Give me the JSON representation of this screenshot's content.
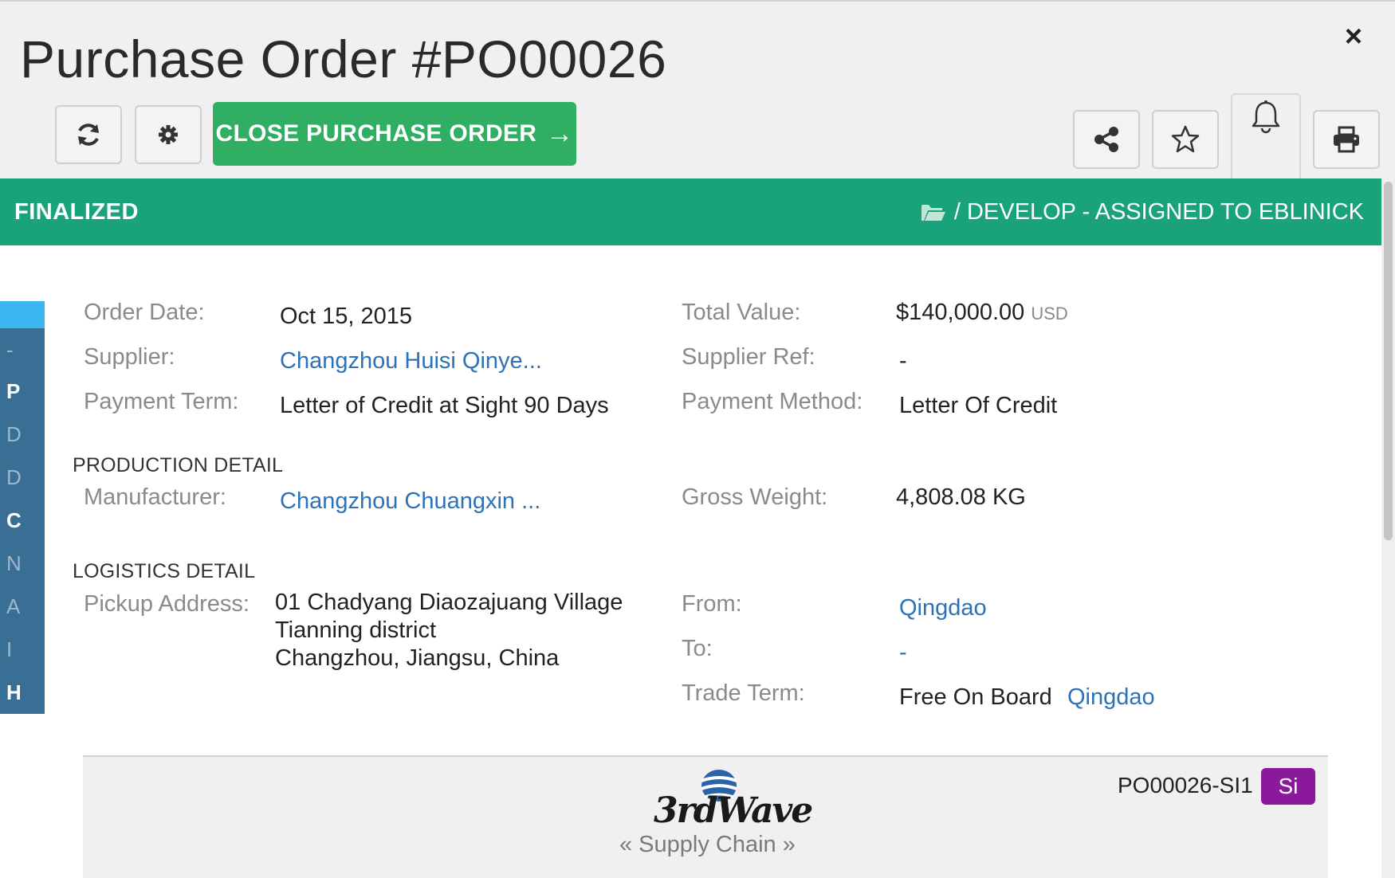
{
  "header": {
    "title": "Purchase Order #PO00026",
    "close_icon": "×",
    "primary_action": "CLOSE PURCHASE ORDER",
    "primary_action_arrow": "→"
  },
  "status": {
    "state": "FINALIZED",
    "project": "/ DEVELOP - ASSIGNED TO EBLINICK"
  },
  "side_rail": {
    "letters": [
      "-",
      "P",
      "D",
      "D",
      "C",
      "N",
      "A",
      "I",
      "H"
    ]
  },
  "order": {
    "order_date_label": "Order Date:",
    "order_date": "Oct 15, 2015",
    "supplier_label": "Supplier:",
    "supplier": "Changzhou Huisi Qinye...",
    "payment_term_label": "Payment Term:",
    "payment_term": "Letter of Credit at Sight 90 Days",
    "total_value_label": "Total Value:",
    "total_value": "$140,000.00",
    "currency": "USD",
    "supplier_ref_label": "Supplier Ref:",
    "supplier_ref": "-",
    "payment_method_label": "Payment Method:",
    "payment_method": "Letter Of Credit"
  },
  "production": {
    "heading": "PRODUCTION DETAIL",
    "manufacturer_label": "Manufacturer:",
    "manufacturer": "Changzhou Chuangxin ...",
    "gross_weight_label": "Gross Weight:",
    "gross_weight": "4,808.08 KG"
  },
  "logistics": {
    "heading": "LOGISTICS DETAIL",
    "pickup_label": "Pickup Address:",
    "pickup_line1": "01 Chadyang Diaozajuang Village",
    "pickup_line2": "Tianning district",
    "pickup_line3": "Changzhou, Jiangsu, China",
    "from_label": "From:",
    "from": "Qingdao",
    "to_label": "To:",
    "to": "-",
    "trade_term_label": "Trade Term:",
    "trade_term": "Free On Board",
    "trade_term_port": "Qingdao"
  },
  "preview": {
    "logo_text": "3rdWave",
    "tagline": "« Supply Chain »",
    "shipping_instruction_ref": "PO00026-SI1",
    "badge": "Si"
  },
  "colors": {
    "accent_green": "#1aa37a",
    "button_green": "#2fae64",
    "link_blue": "#2d72b8",
    "rail_blue": "#3a6f95",
    "badge_purple": "#8a1a9b"
  }
}
